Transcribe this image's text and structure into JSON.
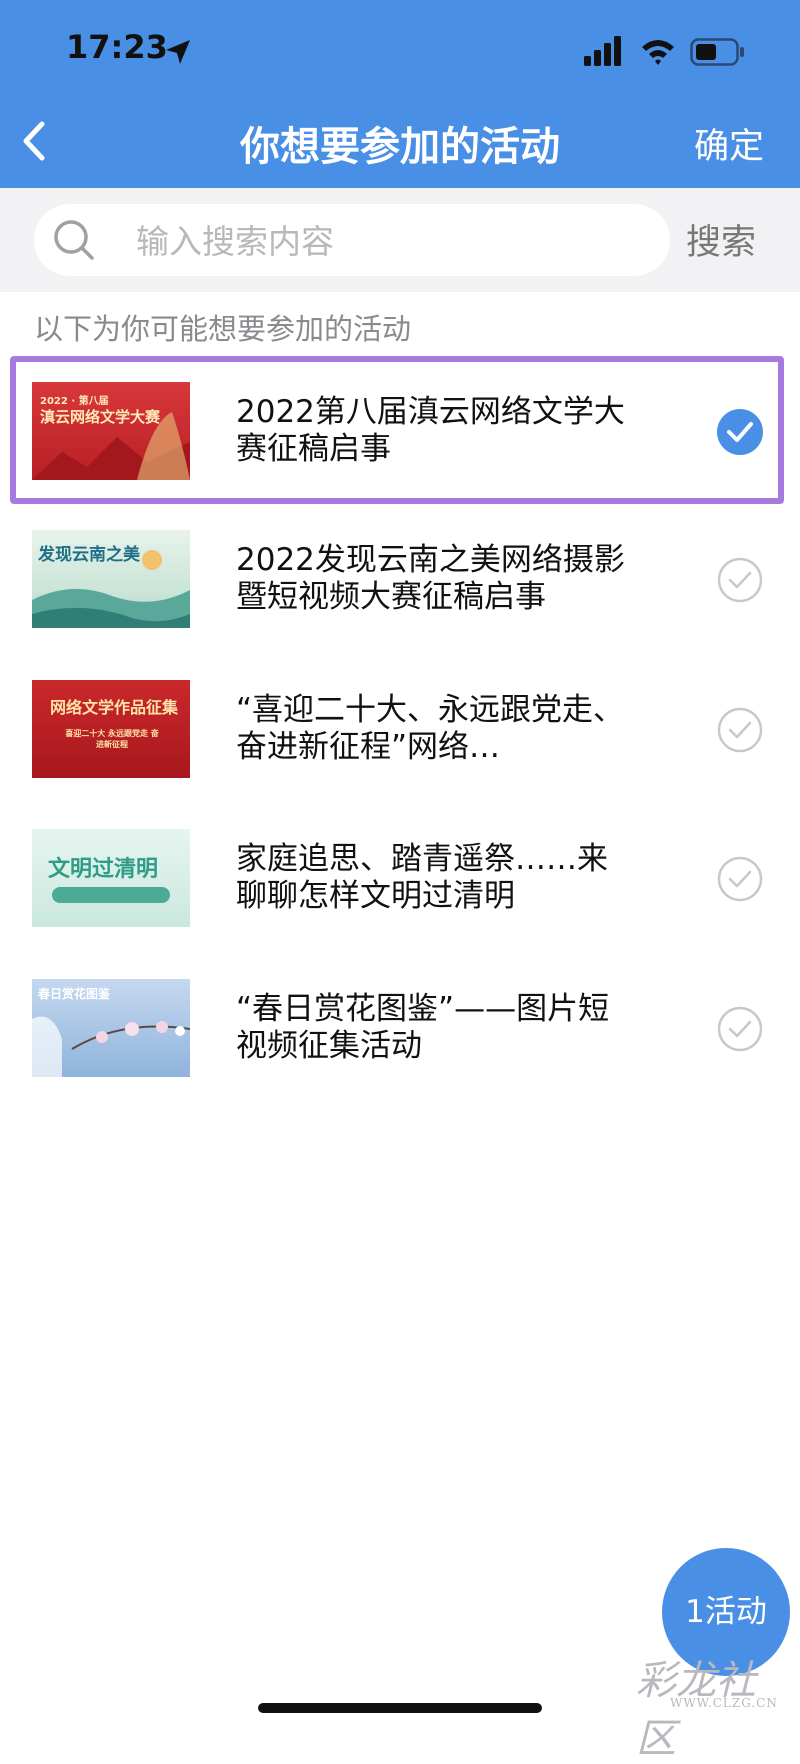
{
  "status_bar": {
    "time": "17:23"
  },
  "nav": {
    "title": "你想要参加的活动",
    "confirm_label": "确定"
  },
  "search": {
    "placeholder": "输入搜索内容",
    "button_label": "搜索"
  },
  "section_title": "以下为你可能想要参加的活动",
  "activities": [
    {
      "title": "2022第八届滇云网络文学大赛征稿启事",
      "selected": true,
      "thumb": {
        "line1": "2022 · 第八届",
        "line2": "滇云网络文学大赛",
        "bg": "#c8262c"
      }
    },
    {
      "title": "2022发现云南之美网络摄影暨短视频大赛征稿启事",
      "selected": false,
      "thumb": {
        "line1": "发现云南之美",
        "bg": "#cfe6dd"
      }
    },
    {
      "title": "“喜迎二十大、永远跟党走、 奋进新征程”网络…",
      "selected": false,
      "thumb": {
        "line1": "网络文学作品征集",
        "line2": "喜迎二十大 永远跟党走 奋进新征程",
        "bg": "#b81f24"
      }
    },
    {
      "title": "家庭追思、踏青遥祭……来聊聊怎样文明过清明",
      "selected": false,
      "thumb": {
        "line1": "文明过清明",
        "bg": "#d9efe8"
      }
    },
    {
      "title": "“春日赏花图鉴”——图片短视频征集活动",
      "selected": false,
      "thumb": {
        "line1": "春日赏花图鉴",
        "bg": "#a9c6e6"
      }
    }
  ],
  "fab": {
    "label": "1活动"
  },
  "watermark": {
    "text": "彩龙社区",
    "sub": "WWW.CLZG.CN"
  },
  "colors": {
    "primary": "#4a8fe6",
    "selection_border": "#a77ae0",
    "check_inactive": "#c8c8cc"
  }
}
